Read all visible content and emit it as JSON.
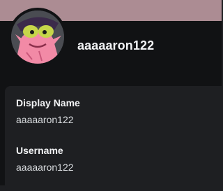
{
  "colors": {
    "banner": "#ac8c93",
    "panel": "#111214",
    "card": "#1e1f22",
    "avatar_character": "#f28aa6"
  },
  "profile": {
    "avatar_icon": "avatar-pink-character-icon",
    "header_name": "aaaaaron122"
  },
  "details": {
    "display_name_label": "Display Name",
    "display_name_value": "aaaaaron122",
    "username_label": "Username",
    "username_value": "aaaaaron122"
  }
}
